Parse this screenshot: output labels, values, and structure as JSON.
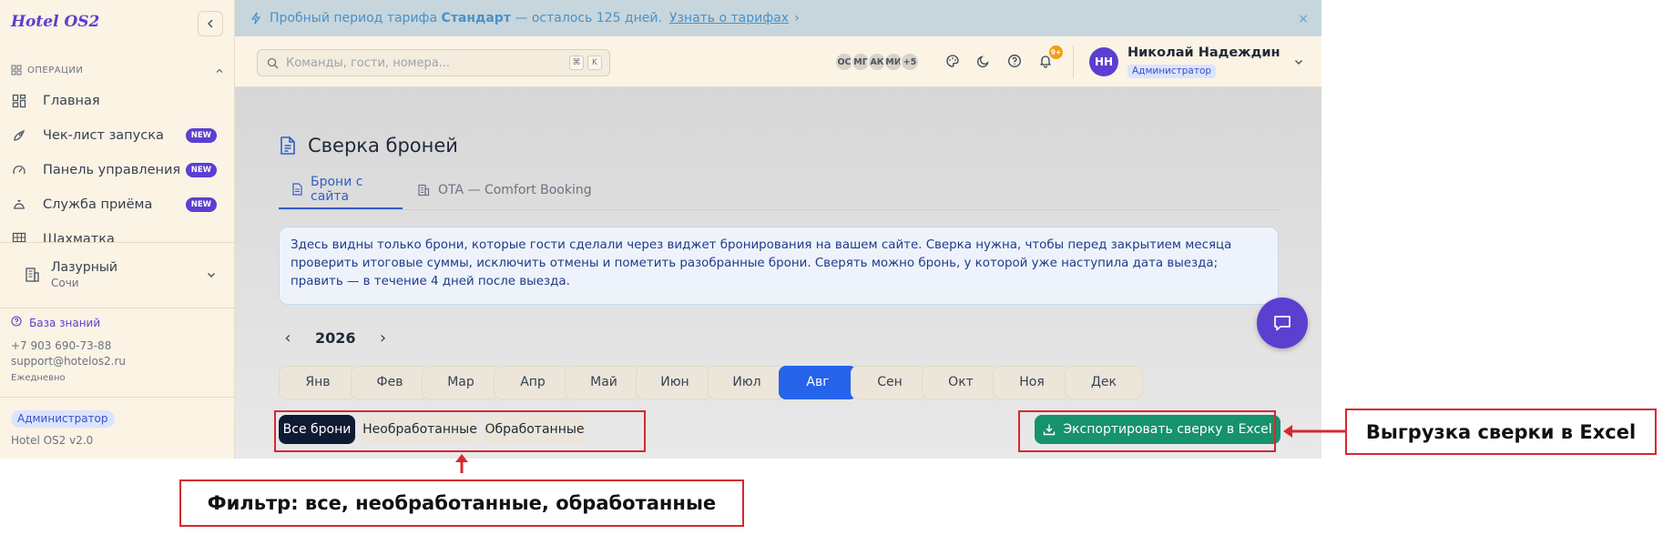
{
  "sidebar": {
    "brand": "Hotel OS2",
    "section_title": "ОПЕРАЦИИ",
    "items": [
      {
        "label": "Главная",
        "badge": ""
      },
      {
        "label": "Чек-лист запуска",
        "badge": "NEW"
      },
      {
        "label": "Панель управления",
        "badge": "NEW"
      },
      {
        "label": "Служба приёма",
        "badge": "NEW"
      },
      {
        "label": "Шахматка",
        "badge": ""
      }
    ],
    "hotel": {
      "name": "Лазурный",
      "city": "Сочи"
    },
    "knowledge_base": "База знаний",
    "phone": "+7 903 690-73-88",
    "email": "support@hotelos2.ru",
    "schedule": "Ежедневно",
    "role": "Администратор",
    "version": "Hotel OS2 v2.0"
  },
  "banner": {
    "prefix": "Пробный период тарифа ",
    "plan": "Стандарт",
    "suffix": " — осталось 125 дней.",
    "link": "Узнать о тарифах",
    "close": "×"
  },
  "topbar": {
    "search_placeholder": "Команды, гости, номера...",
    "kbd": [
      "⌘",
      "K"
    ],
    "avatars": [
      "ОС",
      "МГ",
      "АК",
      "МИ",
      "+5"
    ],
    "notif_count": "9+",
    "user_initials": "НН",
    "user_name": "Николай Надеждин",
    "user_role": "Администратор"
  },
  "main": {
    "title": "Сверка броней",
    "tabs": [
      {
        "label": "Брони с сайта",
        "active": true
      },
      {
        "label": "OTA — Comfort Booking",
        "active": false
      }
    ],
    "info": "Здесь видны только брони, которые гости сделали через виджет бронирования на вашем сайте. Сверка нужна, чтобы перед закрытием месяца проверить итоговые суммы, исключить отмены и пометить разобранные брони. Сверять можно бронь, у которой уже наступила дата выезда; править — в течение 4 дней после выезда.",
    "year": "2026",
    "prev": "‹",
    "next": "›",
    "months": [
      "Янв",
      "Фев",
      "Мар",
      "Апр",
      "Май",
      "Июн",
      "Июл",
      "Авг",
      "Сен",
      "Окт",
      "Ноя",
      "Дек"
    ],
    "active_month": "Авг",
    "filters": [
      "Все брони",
      "Необработанные",
      "Обработанные"
    ],
    "active_filter": "Все брони",
    "export_label": "Экспортировать сверку в Excel"
  },
  "annotations": {
    "filter_note": "Фильтр: все, необработанные, обработанные",
    "export_note": "Выгрузка сверки в Excel",
    "color": "#d7282f"
  },
  "colors": {
    "accent": "#5b3fd1",
    "primary": "#2563eb",
    "export": "#16926c",
    "sidebar_bg": "#fbf3e4"
  }
}
